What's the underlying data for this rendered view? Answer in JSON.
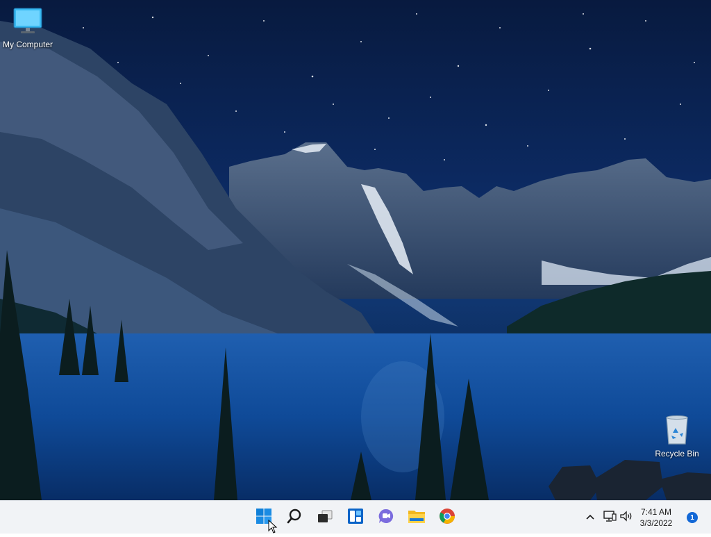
{
  "desktop": {
    "icons": [
      {
        "label": "My Computer",
        "icon": "monitor-icon"
      },
      {
        "label": "Recycle Bin",
        "icon": "recycle-bin-icon"
      }
    ]
  },
  "taskbar": {
    "apps": [
      {
        "name": "start-button",
        "icon": "windows-logo-icon"
      },
      {
        "name": "search-button",
        "icon": "search-icon"
      },
      {
        "name": "task-view-button",
        "icon": "task-view-icon"
      },
      {
        "name": "widgets-button",
        "icon": "widgets-icon"
      },
      {
        "name": "chat-button",
        "icon": "teams-chat-icon"
      },
      {
        "name": "file-explorer-button",
        "icon": "folder-icon"
      },
      {
        "name": "chrome-button",
        "icon": "chrome-icon"
      }
    ],
    "tray": {
      "time": "7:41 AM",
      "date": "3/3/2022",
      "notification_count": "1"
    }
  },
  "colors": {
    "taskbar_bg": "#f1f3f6",
    "accent": "#1368d6",
    "wallpaper_sky": "#0c2a62"
  }
}
